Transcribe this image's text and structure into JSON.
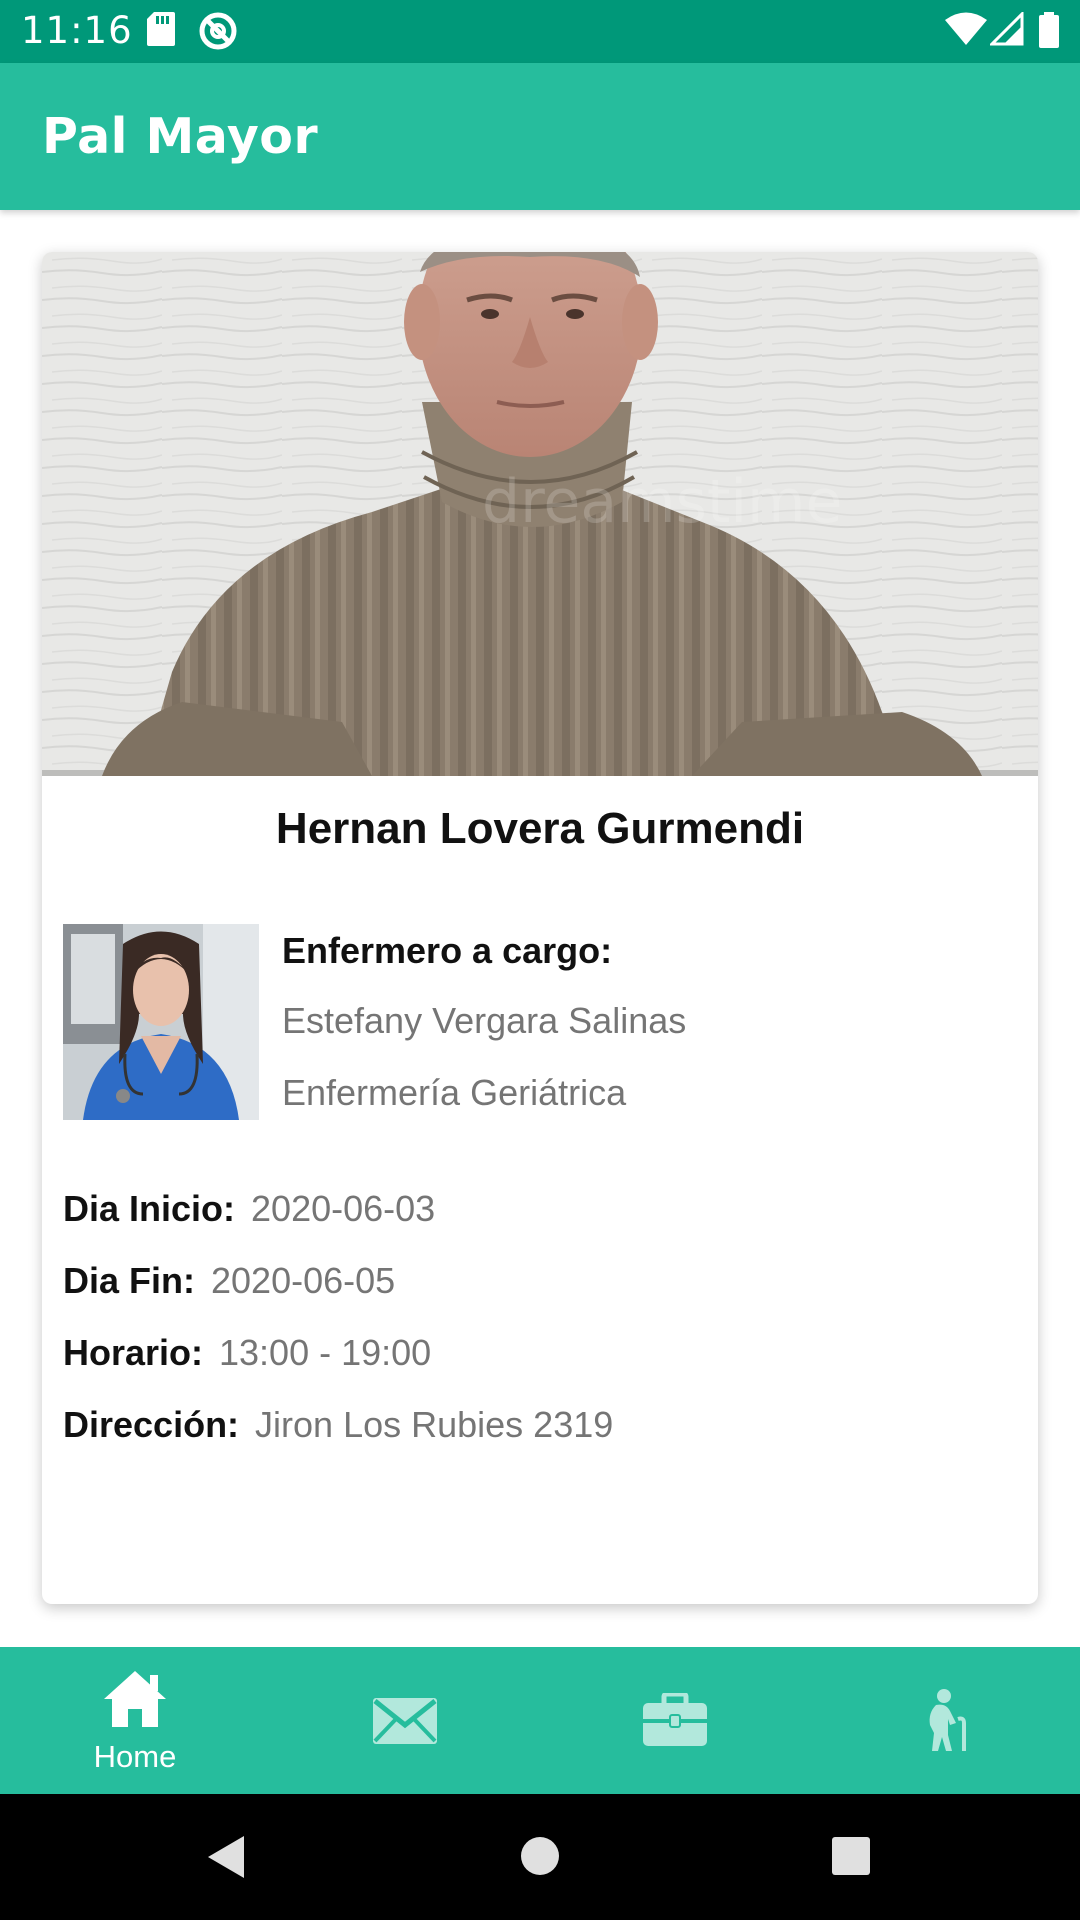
{
  "status_bar": {
    "time": "11:16",
    "icons": [
      "sd-card-icon",
      "at-sign-icon",
      "wifi-icon",
      "signal-icon",
      "battery-icon"
    ]
  },
  "app_bar": {
    "title": "Pal Mayor"
  },
  "card": {
    "elder_name": "Hernan Lovera Gurmendi",
    "nurse": {
      "heading": "Enfermero a cargo:",
      "name": "Estefany Vergara Salinas",
      "specialty": "Enfermería Geriátrica"
    },
    "details": [
      {
        "label": "Dia Inicio:",
        "value": "2020-06-03"
      },
      {
        "label": "Dia Fin:",
        "value": "2020-06-05"
      },
      {
        "label": "Horario:",
        "value": "13:00 - 19:00"
      },
      {
        "label": "Dirección:",
        "value": "Jiron Los Rubies 2319"
      }
    ]
  },
  "bottom_nav": {
    "items": [
      {
        "label": "Home",
        "icon": "home-icon",
        "active": true
      },
      {
        "label": "",
        "icon": "mail-icon",
        "active": false
      },
      {
        "label": "",
        "icon": "briefcase-icon",
        "active": false
      },
      {
        "label": "",
        "icon": "elderly-person-icon",
        "active": false
      }
    ]
  },
  "colors": {
    "status_bar": "#009879",
    "primary": "#26bd9d",
    "inactive_icon": "#b2e8dc",
    "label_text": "#111111",
    "value_text": "#757575"
  }
}
